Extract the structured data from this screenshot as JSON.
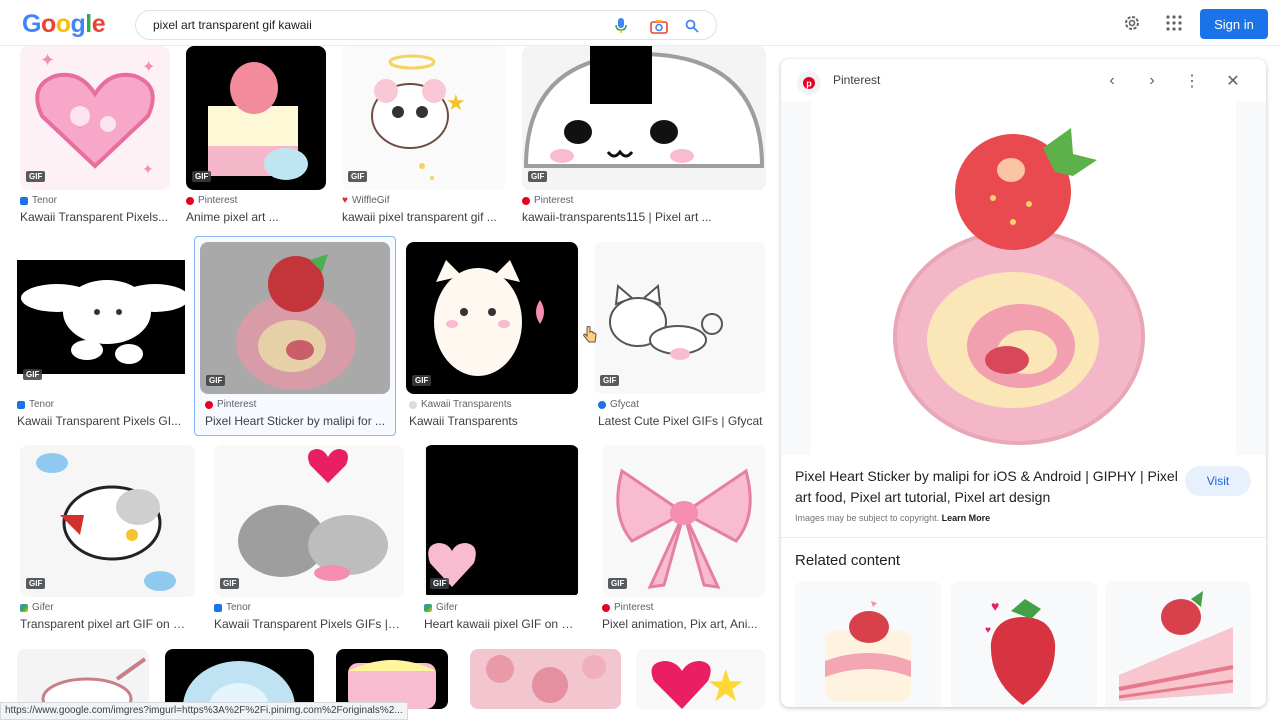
{
  "header": {
    "logo": [
      "G",
      "o",
      "o",
      "g",
      "l",
      "e"
    ],
    "search_query": "pixel art transparent gif kawaii",
    "sign_in": "Sign in"
  },
  "gif_label": "GIF",
  "results": [
    {
      "source": "Tenor",
      "title": "Kawaii Transparent Pixels..."
    },
    {
      "source": "Pinterest",
      "title": "Anime pixel art ..."
    },
    {
      "source": "WiffleGif",
      "title": "kawaii pixel transparent gif ..."
    },
    {
      "source": "Pinterest",
      "title": "kawaii-transparents115 | Pixel art ..."
    },
    {
      "source": "Tenor",
      "title": "Kawaii Transparent Pixels GI..."
    },
    {
      "source": "Pinterest",
      "title": "Pixel Heart Sticker by malipi for ..."
    },
    {
      "source": "Kawaii Transparents",
      "title": "Kawaii Transparents"
    },
    {
      "source": "Gfycat",
      "title": "Latest Cute Pixel GIFs | Gfycat"
    },
    {
      "source": "Gifer",
      "title": "Transparent pixel art GIF on GI..."
    },
    {
      "source": "Tenor",
      "title": "Kawaii Transparent Pixels GIFs | ..."
    },
    {
      "source": "Gifer",
      "title": "Heart kawaii pixel GIF on GI..."
    },
    {
      "source": "Pinterest",
      "title": "Pixel animation, Pix art, Ani..."
    }
  ],
  "panel": {
    "source": "Pinterest",
    "title": "Pixel Heart Sticker by malipi for iOS & Android | GIPHY | Pixel art food, Pixel art tutorial, Pixel art design",
    "visit": "Visit",
    "copyright": "Images may be subject to copyright.",
    "learn_more": "Learn More",
    "related_heading": "Related content"
  },
  "status_url": "https://www.google.com/imgres?imgurl=https%3A%2F%2Fi.pinimg.com%2Foriginals%2..."
}
